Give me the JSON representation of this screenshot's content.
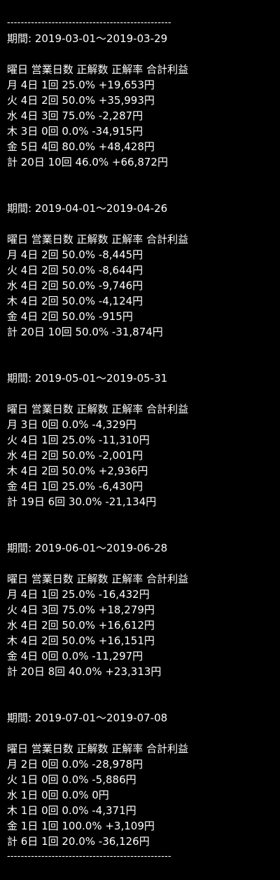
{
  "separator": "------------------------------------------------",
  "periods": [
    {
      "period": "期間: 2019-03-01～2019-03-29",
      "header": "曜日 営業日数 正解数 正解率 合計利益",
      "rows": [
        "月 4日 1回 25.0% +19,653円",
        "火 4日 2回 50.0% +35,993円",
        "水 4日 3回 75.0% -2,287円",
        "木 3日 0回 0.0% -34,915円",
        "金 5日 4回 80.0% +48,428円",
        "計 20日 10回 46.0% +66,872円"
      ]
    },
    {
      "period": "期間: 2019-04-01～2019-04-26",
      "header": "曜日 営業日数 正解数 正解率 合計利益",
      "rows": [
        "月 4日 2回 50.0% -8,445円",
        "火 4日 2回 50.0% -8,644円",
        "水 4日 2回 50.0% -9,746円",
        "木 4日 2回 50.0% -4,124円",
        "金 4日 2回 50.0% -915円",
        "計 20日 10回 50.0% -31,874円"
      ]
    },
    {
      "period": "期間: 2019-05-01～2019-05-31",
      "header": "曜日 営業日数 正解数 正解率 合計利益",
      "rows": [
        "月 3日 0回 0.0% -4,329円",
        "火 4日 1回 25.0% -11,310円",
        "水 4日 2回 50.0% -2,001円",
        "木 4日 2回 50.0% +2,936円",
        "金 4日 1回 25.0% -6,430円",
        "計 19日 6回 30.0% -21,134円"
      ]
    },
    {
      "period": "期間: 2019-06-01～2019-06-28",
      "header": "曜日 営業日数 正解数 正解率 合計利益",
      "rows": [
        "月 4日 1回 25.0% -16,432円",
        "火 4日 3回 75.0% +18,279円",
        "水 4日 2回 50.0% +16,612円",
        "木 4日 2回 50.0% +16,151円",
        "金 4日 0回 0.0% -11,297円",
        "計 20日 8回 40.0% +23,313円"
      ]
    },
    {
      "period": "期間: 2019-07-01～2019-07-08",
      "header": "曜日 営業日数 正解数 正解率 合計利益",
      "rows": [
        "月 2日 0回 0.0% -28,978円",
        "火 1日 0回 0.0% -5,886円",
        "水 1日 0回 0.0% 0円",
        "木 1日 0回 0.0% -4,371円",
        "金 1日 1回 100.0% +3,109円",
        "計 6日 1回 20.0% -36,126円"
      ]
    }
  ]
}
